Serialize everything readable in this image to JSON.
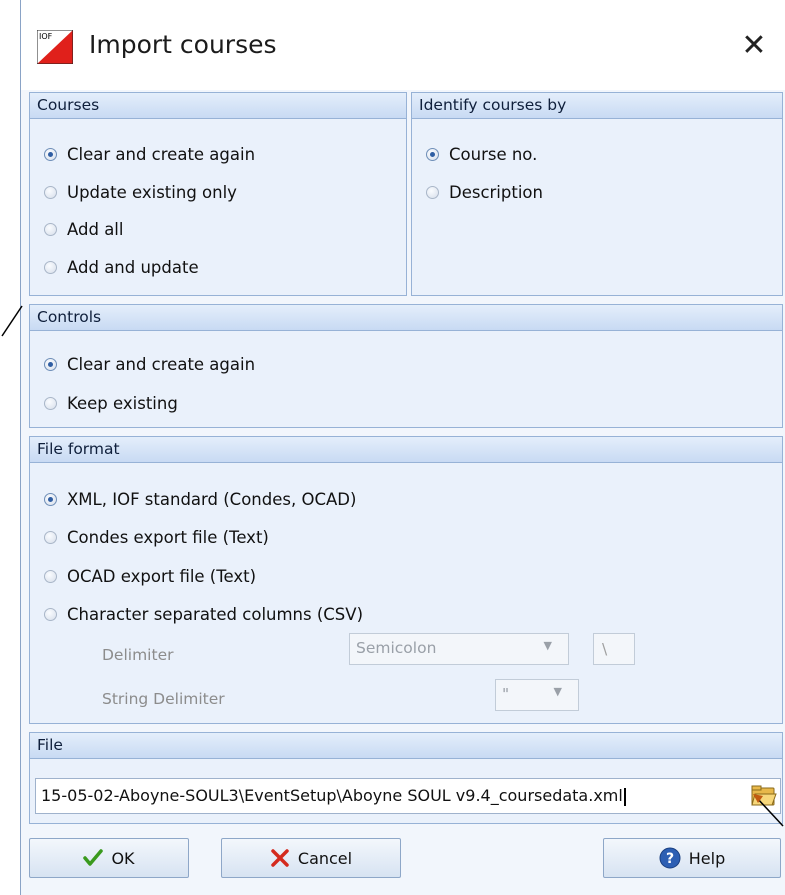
{
  "dialog": {
    "title": "Import courses",
    "logo_text": "IOF"
  },
  "courses": {
    "header": "Courses",
    "options": [
      "Clear and create again",
      "Update existing only",
      "Add all",
      "Add and update"
    ],
    "selected": "Clear and create again"
  },
  "identify": {
    "header": "Identify courses by",
    "options": [
      "Course no.",
      "Description"
    ],
    "selected": "Course no."
  },
  "controls": {
    "header": "Controls",
    "options": [
      "Clear and create again",
      "Keep existing"
    ],
    "selected": "Clear and create again"
  },
  "file_format": {
    "header": "File format",
    "options": [
      "XML, IOF standard (Condes, OCAD)",
      "Condes export file (Text)",
      "OCAD export file (Text)",
      "Character separated columns (CSV)"
    ],
    "selected": "XML, IOF standard (Condes, OCAD)",
    "delimiter_label": "Delimiter",
    "delimiter_value": "Semicolon",
    "delimiter_extra": "\\",
    "string_delimiter_label": "String Delimiter",
    "string_delimiter_value": "\""
  },
  "file": {
    "header": "File",
    "path": "15-05-02-Aboyne-SOUL3\\EventSetup\\Aboyne SOUL v9.4_coursedata.xml"
  },
  "buttons": {
    "ok": "OK",
    "cancel": "Cancel",
    "help": "Help"
  },
  "colors": {
    "header_text": "#0f1f3b",
    "ok_check": "#3a9a1e",
    "cancel_x": "#d42a1e",
    "help_icon": "#2d5fb3"
  }
}
